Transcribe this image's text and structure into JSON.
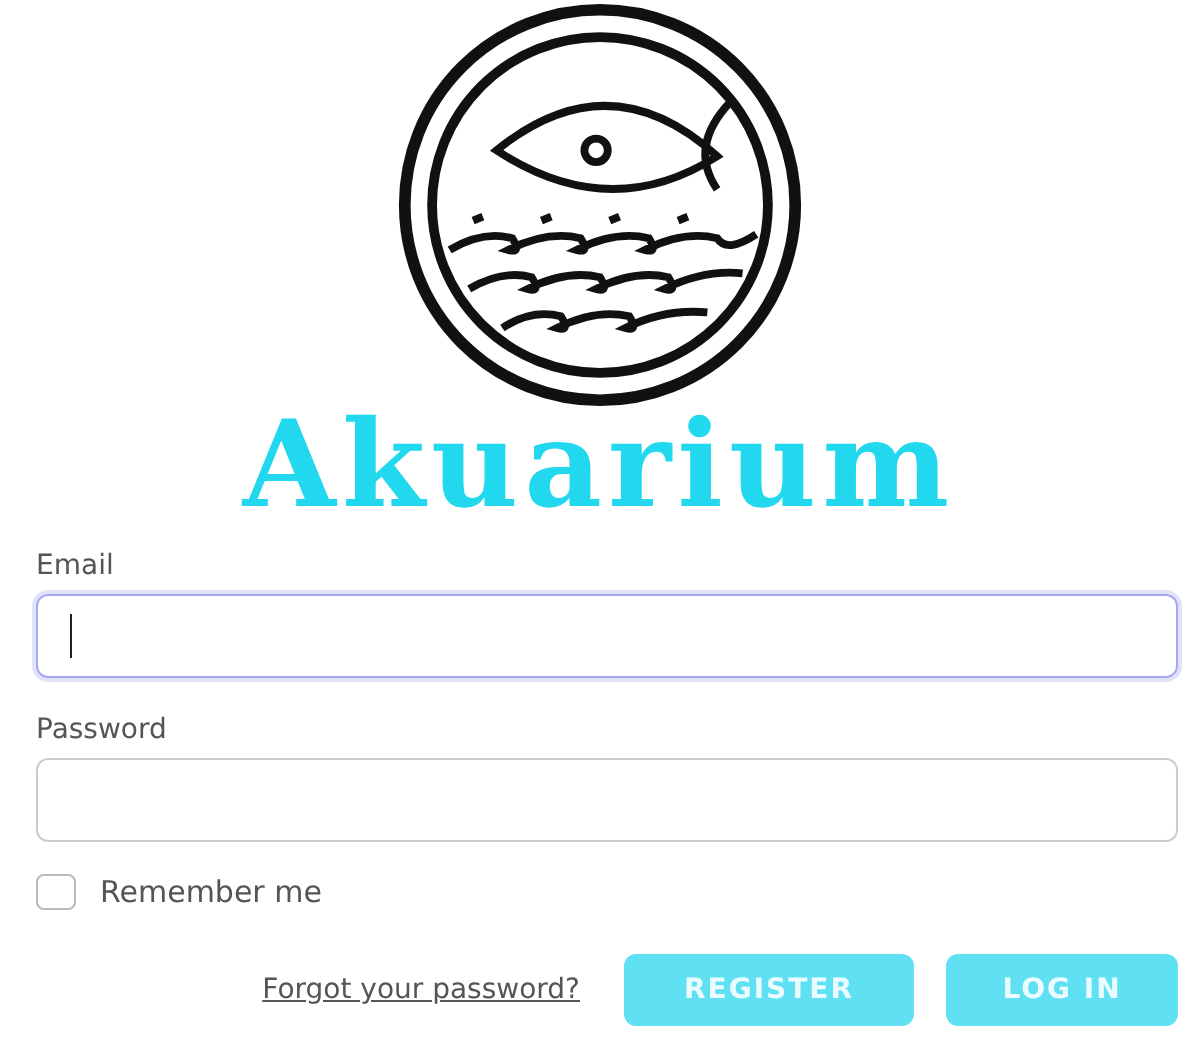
{
  "brand": {
    "title": "Akuarium"
  },
  "fields": [
    {
      "label": "Email",
      "focused": true
    },
    {
      "label": "Password",
      "focused": false
    }
  ],
  "remember": {
    "label": "Remember me",
    "checked": false
  },
  "forgot_link": "Forgot your password?",
  "buttons": [
    "REGISTER",
    "LOG IN"
  ]
}
